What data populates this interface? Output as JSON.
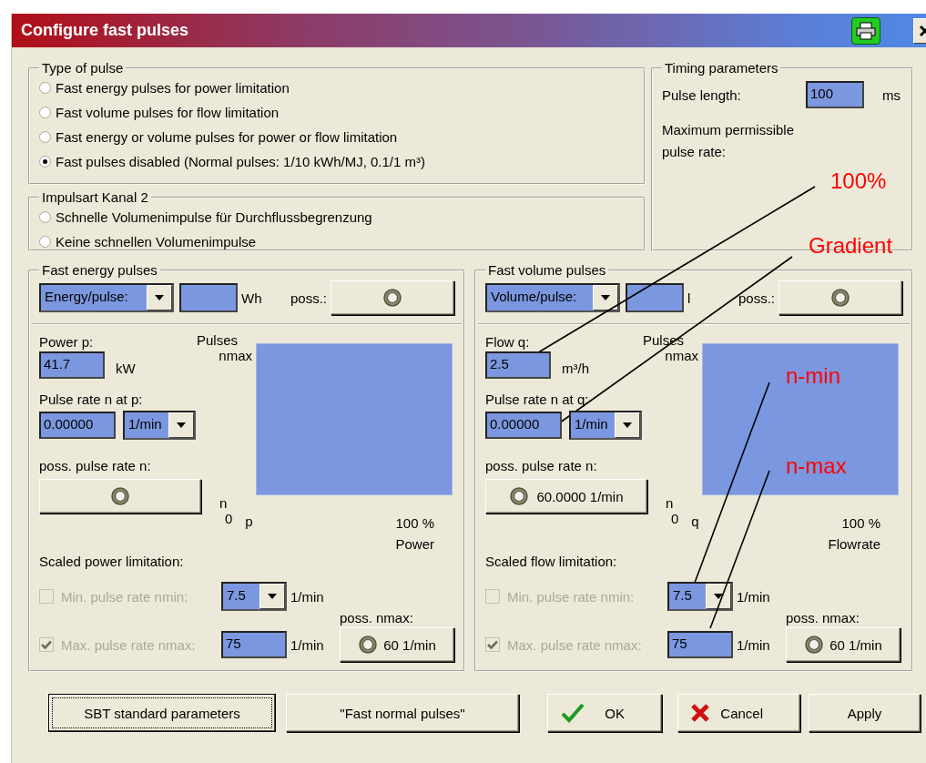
{
  "window": {
    "title": "Configure fast pulses"
  },
  "type_of_pulse": {
    "title": "Type of pulse",
    "options": [
      {
        "label": "Fast energy pulses for power limitation",
        "selected": false
      },
      {
        "label": "Fast volume pulses for flow limitation",
        "selected": false
      },
      {
        "label": "Fast energy or volume pulses for power or flow limitation",
        "selected": false
      },
      {
        "label": "Fast pulses disabled (Normal pulses: 1/10 kWh/MJ, 0.1/1 m³)",
        "selected": true
      }
    ]
  },
  "impulsart_kanal_2": {
    "title": "Impulsart Kanal 2",
    "options": [
      {
        "label": "Schnelle Volumenimpulse für Durchflussbegrenzung",
        "selected": false
      },
      {
        "label": "Keine schnellen Volumenimpulse",
        "selected": false
      }
    ]
  },
  "timing_parameters": {
    "title": "Timing parameters",
    "pulse_length_label": "Pulse length:",
    "pulse_length_value": "100",
    "pulse_length_unit": "ms",
    "max_rate_label": "Maximum permissible pulse rate:"
  },
  "energy": {
    "title": "Fast energy pulses",
    "mode_select": "Energy/pulse:",
    "amount_unit": "Wh",
    "poss_label": "poss.:",
    "param_label": "Power p:",
    "param_value": "41.7",
    "param_unit": "kW",
    "rate_label": "Pulse rate n at p:",
    "rate_value": "0.00000",
    "rate_unit": "1/min",
    "poss_rate_label": "poss. pulse rate n:",
    "chart_labels": {
      "pulses": "Pulses",
      "nmax": "nmax",
      "n": "n",
      "zero": "0",
      "axis": "p",
      "percent": "100 %",
      "quantity": "Power"
    },
    "scaled_label": "Scaled power limitation:",
    "min_rate": {
      "label": "Min. pulse rate nmin:",
      "checked": false,
      "disabled": true,
      "value": "7.5",
      "unit": "1/min"
    },
    "max_rate": {
      "label": "Max. pulse rate nmax:",
      "checked": true,
      "disabled": true,
      "value": "75",
      "unit": "1/min"
    },
    "poss_nmax_label": "poss. nmax:",
    "poss_nmax_button": "60 1/min"
  },
  "volume": {
    "title": "Fast volume pulses",
    "mode_select": "Volume/pulse:",
    "amount_unit": "l",
    "poss_label": "poss.:",
    "param_label": "Flow q:",
    "param_value": "2.5",
    "param_unit": "m³/h",
    "rate_label": "Pulse rate n at q:",
    "rate_value": "0.00000",
    "rate_unit": "1/min",
    "poss_rate_label": "poss. pulse rate n:",
    "poss_rate_button": "60.0000 1/min",
    "chart_labels": {
      "pulses": "Pulses",
      "nmax": "nmax",
      "n": "n",
      "zero": "0",
      "axis": "q",
      "percent": "100 %",
      "quantity": "Flowrate"
    },
    "scaled_label": "Scaled flow limitation:",
    "min_rate": {
      "label": "Min. pulse rate nmin:",
      "checked": false,
      "disabled": true,
      "value": "7.5",
      "unit": "1/min"
    },
    "max_rate": {
      "label": "Max. pulse rate nmax:",
      "checked": true,
      "disabled": true,
      "value": "75",
      "unit": "1/min"
    },
    "poss_nmax_label": "poss. nmax:",
    "poss_nmax_button": "60 1/min"
  },
  "buttons": [
    {
      "label": "SBT standard parameters",
      "focused": true
    },
    {
      "label": "\"Fast normal pulses\"",
      "focused": false
    },
    {
      "label": "OK",
      "kind": "ok",
      "focused": false
    },
    {
      "label": "Cancel",
      "kind": "cancel",
      "focused": false
    },
    {
      "label": "Apply",
      "focused": false
    }
  ],
  "annotations": [
    {
      "text": "100%"
    },
    {
      "text": "Gradient"
    },
    {
      "text": "n-min"
    },
    {
      "text": "n-max"
    }
  ]
}
